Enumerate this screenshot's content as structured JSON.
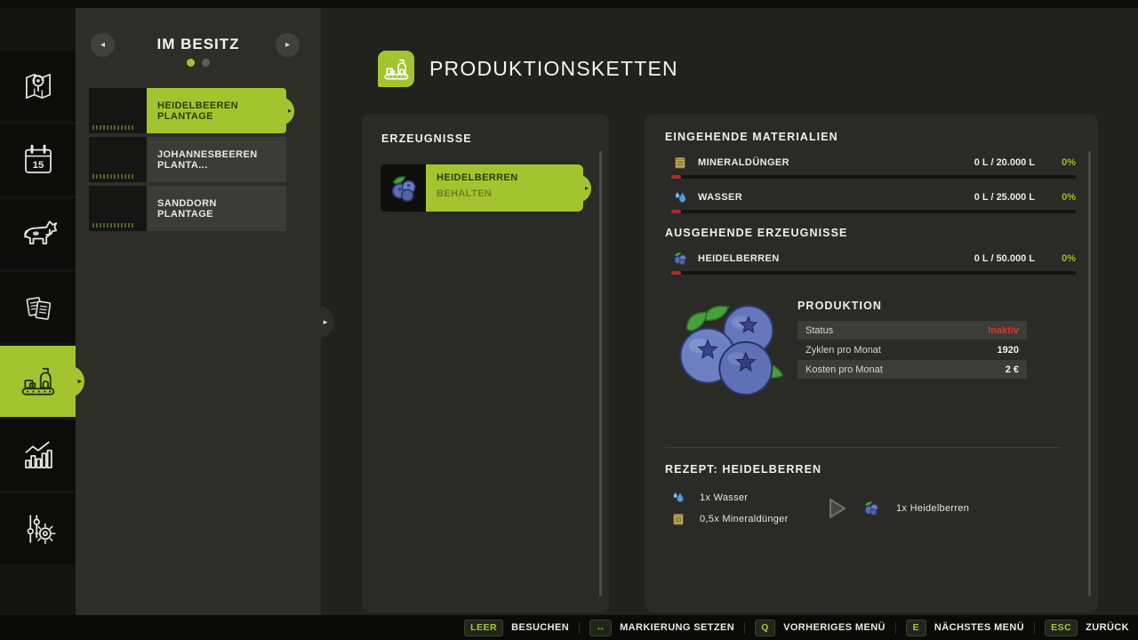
{
  "colors": {
    "accent_green": "#a2c52f",
    "status_red": "#d4392e",
    "percent_green": "#98be2c",
    "progress_tick_red": "#a63029"
  },
  "sidebar": {
    "items": [
      {
        "id": "map",
        "icon": "map-icon"
      },
      {
        "id": "calendar",
        "icon": "calendar-icon",
        "day": "15"
      },
      {
        "id": "animals",
        "icon": "cow-icon"
      },
      {
        "id": "finances",
        "icon": "documents-icon"
      },
      {
        "id": "production",
        "icon": "production-icon",
        "active": true
      },
      {
        "id": "statistics",
        "icon": "bar-chart-icon"
      },
      {
        "id": "settings",
        "icon": "sliders-gear-icon"
      }
    ]
  },
  "owned_panel": {
    "title": "IM BESITZ",
    "pager": {
      "active_dot": 1,
      "total_dots": 2
    },
    "items": [
      {
        "label": "HEIDELBEEREN PLANTAGE",
        "selected": true
      },
      {
        "label": "JOHANNESBEEREN PLANTA...",
        "selected": false
      },
      {
        "label": "SANDDORN PLANTAGE",
        "selected": false
      }
    ]
  },
  "main": {
    "title": "PRODUKTIONSKETTEN"
  },
  "products_panel": {
    "title": "ERZEUGNISSE",
    "items": [
      {
        "name": "HEIDELBERREN",
        "mode": "BEHALTEN",
        "selected": true
      }
    ]
  },
  "details_panel": {
    "inputs_title": "EINGEHENDE MATERIALIEN",
    "inputs": [
      {
        "name": "MINERALDÜNGER",
        "amount": "0 L / 20.000 L",
        "percent": "0%",
        "icon": "fertilizer-icon"
      },
      {
        "name": "WASSER",
        "amount": "0 L / 25.000 L",
        "percent": "0%",
        "icon": "water-icon"
      }
    ],
    "outputs_title": "AUSGEHENDE ERZEUGNISSE",
    "outputs": [
      {
        "name": "HEIDELBERREN",
        "amount": "0 L / 50.000 L",
        "percent": "0%",
        "icon": "blueberry-icon"
      }
    ],
    "production": {
      "title": "PRODUKTION",
      "rows": [
        {
          "label": "Status",
          "value": "Inaktiv",
          "status": "inactive"
        },
        {
          "label": "Zyklen pro Monat",
          "value": "1920"
        },
        {
          "label": "Kosten pro Monat",
          "value": "2 €"
        }
      ]
    },
    "recipe": {
      "title": "REZEPT: HEIDELBERREN",
      "inputs": [
        "1x Wasser",
        "0,5x Mineraldünger"
      ],
      "output": "1x Heidelberren"
    }
  },
  "footer": {
    "hints": [
      {
        "key": "LEER",
        "label": "BESUCHEN"
      },
      {
        "key": "↔",
        "label": "MARKIERUNG SETZEN"
      },
      {
        "key": "Q",
        "label": "VORHERIGES MENÜ"
      },
      {
        "key": "E",
        "label": "NÄCHSTES MENÜ"
      },
      {
        "key": "ESC",
        "label": "ZURÜCK"
      }
    ]
  }
}
